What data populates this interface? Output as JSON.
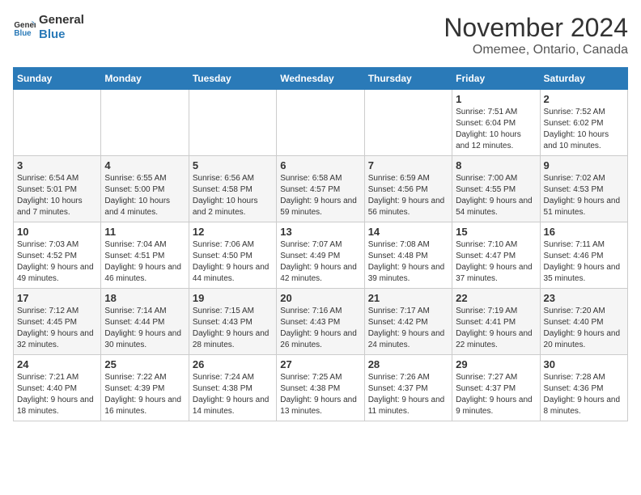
{
  "logo": {
    "line1": "General",
    "line2": "Blue"
  },
  "title": "November 2024",
  "location": "Omemee, Ontario, Canada",
  "days_of_week": [
    "Sunday",
    "Monday",
    "Tuesday",
    "Wednesday",
    "Thursday",
    "Friday",
    "Saturday"
  ],
  "weeks": [
    [
      {
        "day": "",
        "info": ""
      },
      {
        "day": "",
        "info": ""
      },
      {
        "day": "",
        "info": ""
      },
      {
        "day": "",
        "info": ""
      },
      {
        "day": "",
        "info": ""
      },
      {
        "day": "1",
        "info": "Sunrise: 7:51 AM\nSunset: 6:04 PM\nDaylight: 10 hours and 12 minutes."
      },
      {
        "day": "2",
        "info": "Sunrise: 7:52 AM\nSunset: 6:02 PM\nDaylight: 10 hours and 10 minutes."
      }
    ],
    [
      {
        "day": "3",
        "info": "Sunrise: 6:54 AM\nSunset: 5:01 PM\nDaylight: 10 hours and 7 minutes."
      },
      {
        "day": "4",
        "info": "Sunrise: 6:55 AM\nSunset: 5:00 PM\nDaylight: 10 hours and 4 minutes."
      },
      {
        "day": "5",
        "info": "Sunrise: 6:56 AM\nSunset: 4:58 PM\nDaylight: 10 hours and 2 minutes."
      },
      {
        "day": "6",
        "info": "Sunrise: 6:58 AM\nSunset: 4:57 PM\nDaylight: 9 hours and 59 minutes."
      },
      {
        "day": "7",
        "info": "Sunrise: 6:59 AM\nSunset: 4:56 PM\nDaylight: 9 hours and 56 minutes."
      },
      {
        "day": "8",
        "info": "Sunrise: 7:00 AM\nSunset: 4:55 PM\nDaylight: 9 hours and 54 minutes."
      },
      {
        "day": "9",
        "info": "Sunrise: 7:02 AM\nSunset: 4:53 PM\nDaylight: 9 hours and 51 minutes."
      }
    ],
    [
      {
        "day": "10",
        "info": "Sunrise: 7:03 AM\nSunset: 4:52 PM\nDaylight: 9 hours and 49 minutes."
      },
      {
        "day": "11",
        "info": "Sunrise: 7:04 AM\nSunset: 4:51 PM\nDaylight: 9 hours and 46 minutes."
      },
      {
        "day": "12",
        "info": "Sunrise: 7:06 AM\nSunset: 4:50 PM\nDaylight: 9 hours and 44 minutes."
      },
      {
        "day": "13",
        "info": "Sunrise: 7:07 AM\nSunset: 4:49 PM\nDaylight: 9 hours and 42 minutes."
      },
      {
        "day": "14",
        "info": "Sunrise: 7:08 AM\nSunset: 4:48 PM\nDaylight: 9 hours and 39 minutes."
      },
      {
        "day": "15",
        "info": "Sunrise: 7:10 AM\nSunset: 4:47 PM\nDaylight: 9 hours and 37 minutes."
      },
      {
        "day": "16",
        "info": "Sunrise: 7:11 AM\nSunset: 4:46 PM\nDaylight: 9 hours and 35 minutes."
      }
    ],
    [
      {
        "day": "17",
        "info": "Sunrise: 7:12 AM\nSunset: 4:45 PM\nDaylight: 9 hours and 32 minutes."
      },
      {
        "day": "18",
        "info": "Sunrise: 7:14 AM\nSunset: 4:44 PM\nDaylight: 9 hours and 30 minutes."
      },
      {
        "day": "19",
        "info": "Sunrise: 7:15 AM\nSunset: 4:43 PM\nDaylight: 9 hours and 28 minutes."
      },
      {
        "day": "20",
        "info": "Sunrise: 7:16 AM\nSunset: 4:43 PM\nDaylight: 9 hours and 26 minutes."
      },
      {
        "day": "21",
        "info": "Sunrise: 7:17 AM\nSunset: 4:42 PM\nDaylight: 9 hours and 24 minutes."
      },
      {
        "day": "22",
        "info": "Sunrise: 7:19 AM\nSunset: 4:41 PM\nDaylight: 9 hours and 22 minutes."
      },
      {
        "day": "23",
        "info": "Sunrise: 7:20 AM\nSunset: 4:40 PM\nDaylight: 9 hours and 20 minutes."
      }
    ],
    [
      {
        "day": "24",
        "info": "Sunrise: 7:21 AM\nSunset: 4:40 PM\nDaylight: 9 hours and 18 minutes."
      },
      {
        "day": "25",
        "info": "Sunrise: 7:22 AM\nSunset: 4:39 PM\nDaylight: 9 hours and 16 minutes."
      },
      {
        "day": "26",
        "info": "Sunrise: 7:24 AM\nSunset: 4:38 PM\nDaylight: 9 hours and 14 minutes."
      },
      {
        "day": "27",
        "info": "Sunrise: 7:25 AM\nSunset: 4:38 PM\nDaylight: 9 hours and 13 minutes."
      },
      {
        "day": "28",
        "info": "Sunrise: 7:26 AM\nSunset: 4:37 PM\nDaylight: 9 hours and 11 minutes."
      },
      {
        "day": "29",
        "info": "Sunrise: 7:27 AM\nSunset: 4:37 PM\nDaylight: 9 hours and 9 minutes."
      },
      {
        "day": "30",
        "info": "Sunrise: 7:28 AM\nSunset: 4:36 PM\nDaylight: 9 hours and 8 minutes."
      }
    ]
  ]
}
